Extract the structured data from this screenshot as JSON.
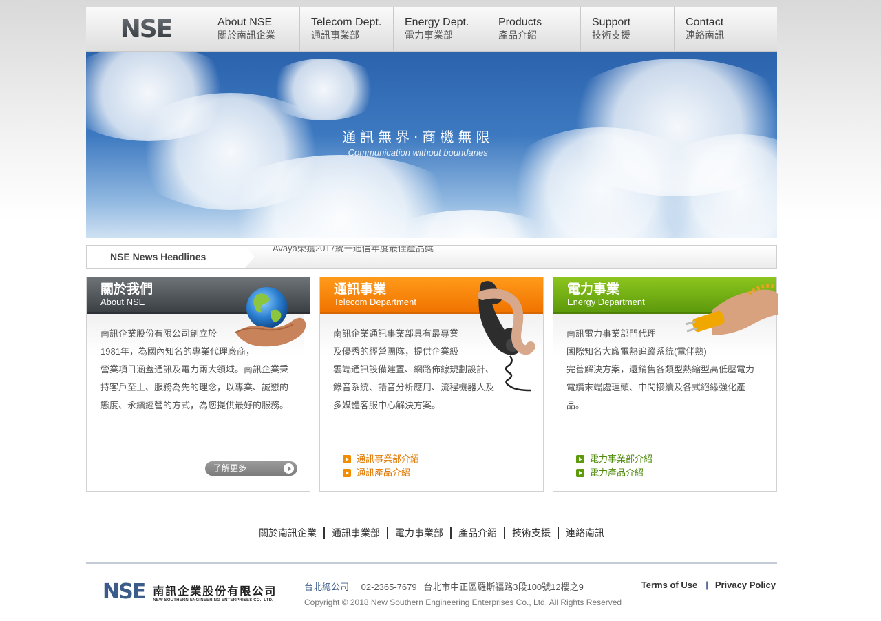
{
  "nav": {
    "logo": "NSE",
    "items": [
      {
        "en": "About NSE",
        "zh": "關於南訊企業"
      },
      {
        "en": "Telecom Dept.",
        "zh": "通訊事業部"
      },
      {
        "en": "Energy Dept.",
        "zh": "電力事業部"
      },
      {
        "en": "Products",
        "zh": "產品介紹"
      },
      {
        "en": "Support",
        "zh": "技術支援"
      },
      {
        "en": "Contact",
        "zh": "連絡南訊"
      }
    ]
  },
  "banner": {
    "zh": "通訊無界·商機無限",
    "en": "Communication without boundaries"
  },
  "news": {
    "label": "NSE News Headlines",
    "headlines": [
      "Avaya榮獲2017統一通信年度最佳產品獎"
    ]
  },
  "cards": {
    "about": {
      "title_zh": "關於我們",
      "title_en": "About NSE",
      "lines": [
        "南訊企業股份有限公司創立於",
        "1981年，為國內知名的專業代理廠商，",
        "營業項目涵蓋通訊及電力兩大領域。南訊企業秉",
        "持客戶至上、服務為先的理念，以專業、誠懇的",
        "態度、永續經營的方式，為您提供最好的服務。"
      ],
      "more": "了解更多"
    },
    "telecom": {
      "title_zh": "通訊事業",
      "title_en": "Telecom Department",
      "lines": [
        "南訊企業通訊事業部具有最專業",
        "及優秀的經營團隊，提供企業級",
        "雲端通訊設備建置、網路佈線規劃設計、",
        "錄音系統、語音分析應用、流程機器人及",
        "多媒體客服中心解決方案。"
      ],
      "links": [
        "通訊事業部介紹",
        "通訊產品介紹"
      ]
    },
    "energy": {
      "title_zh": "電力事業",
      "title_en": "Energy Department",
      "lines": [
        "南訊電力事業部門代理",
        "國際知名大廠電熱追蹤系統(電伴熱)",
        "完善解決方案，還銷售各類型熱縮型高低壓電力",
        "電纜末端處理頭、中間接續及各式絕緣強化產",
        "品。"
      ],
      "links": [
        "電力事業部介紹",
        "電力產品介紹"
      ]
    }
  },
  "footer_links": [
    "關於南訊企業",
    "通訊事業部",
    "電力事業部",
    "產品介紹",
    "技術支援",
    "連絡南訊"
  ],
  "footer": {
    "logo_mark": "NSE",
    "company_zh": "南訊企業股份有限公司",
    "company_en": "NEW SOUTHERN ENGINEERING ENTERPRISES CO., LTD.",
    "hq_label": "台北總公司",
    "phone": "02-2365-7679",
    "address": "台北市中正區羅斯福路3段100號12樓之9",
    "copyright": "Copyright © 2018 New Southern Engineering Enterprises Co., Ltd. All Rights Reserved",
    "terms": "Terms of Use",
    "privacy": "Privacy Policy"
  },
  "colors": {
    "telecom_accent": "#f07400",
    "energy_accent": "#5d9a0c",
    "about_header": "#3b4045",
    "footer_blue": "#3e5f8e"
  }
}
